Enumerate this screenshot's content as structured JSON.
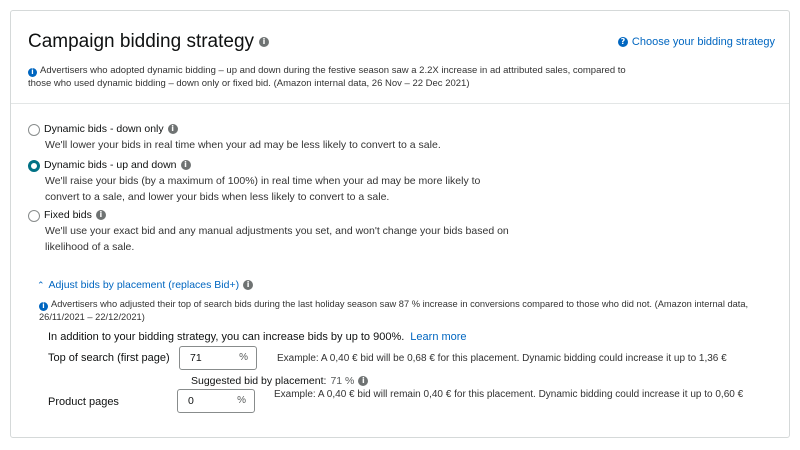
{
  "header": {
    "title": "Campaign bidding strategy",
    "choose_link": "Choose your bidding strategy",
    "note": "Advertisers who adopted dynamic bidding – up and down during the festive season saw a 2.2X increase in ad attributed sales, compared to those who used dynamic bidding – down only or fixed bid. (Amazon internal data, 26 Nov – 22 Dec 2021)"
  },
  "options": [
    {
      "label": "Dynamic bids - down only",
      "description": "We'll lower your bids in real time when your ad may be less likely to convert to a sale.",
      "checked": false
    },
    {
      "label": "Dynamic bids - up and down",
      "description": "We'll raise your bids (by a maximum of 100%) in real time when your ad may be more likely to convert to a sale, and lower your bids when less likely to convert to a sale.",
      "checked": true
    },
    {
      "label": "Fixed bids",
      "description": "We'll use your exact bid and any manual adjustments you set, and won't change your bids based on likelihood of a sale.",
      "checked": false
    }
  ],
  "placement": {
    "toggle_label": "Adjust bids by placement (replaces Bid+)",
    "note": "Advertisers who adjusted their top of search bids during the last holiday season saw 87 % increase in conversions compared to those who did not. (Amazon internal data, 26/11/2021 – 22/12/2021)",
    "increase_text": "In addition to your bidding strategy, you can increase bids by up to 900%.",
    "learn_more": "Learn more",
    "top_of_search": {
      "label": "Top of search (first page)",
      "value": "71",
      "unit": "%",
      "example": "Example: A 0,40 € bid will be 0,68 € for this placement. Dynamic bidding could increase it up to 1,36 €"
    },
    "suggested_label": "Suggested bid by placement:",
    "suggested_value": "71 %",
    "product_pages": {
      "label": "Product pages",
      "value": "0",
      "unit": "%",
      "example": "Example: A 0,40 € bid will remain 0,40 € for this placement. Dynamic bidding could increase it up to 0,60 €"
    }
  },
  "colors": {
    "link": "#0066c0",
    "radio_selected": "#007185",
    "border": "#d5d9d9"
  },
  "icons": {
    "info": "info-circle-icon",
    "chevron": "chevron-up-icon"
  }
}
